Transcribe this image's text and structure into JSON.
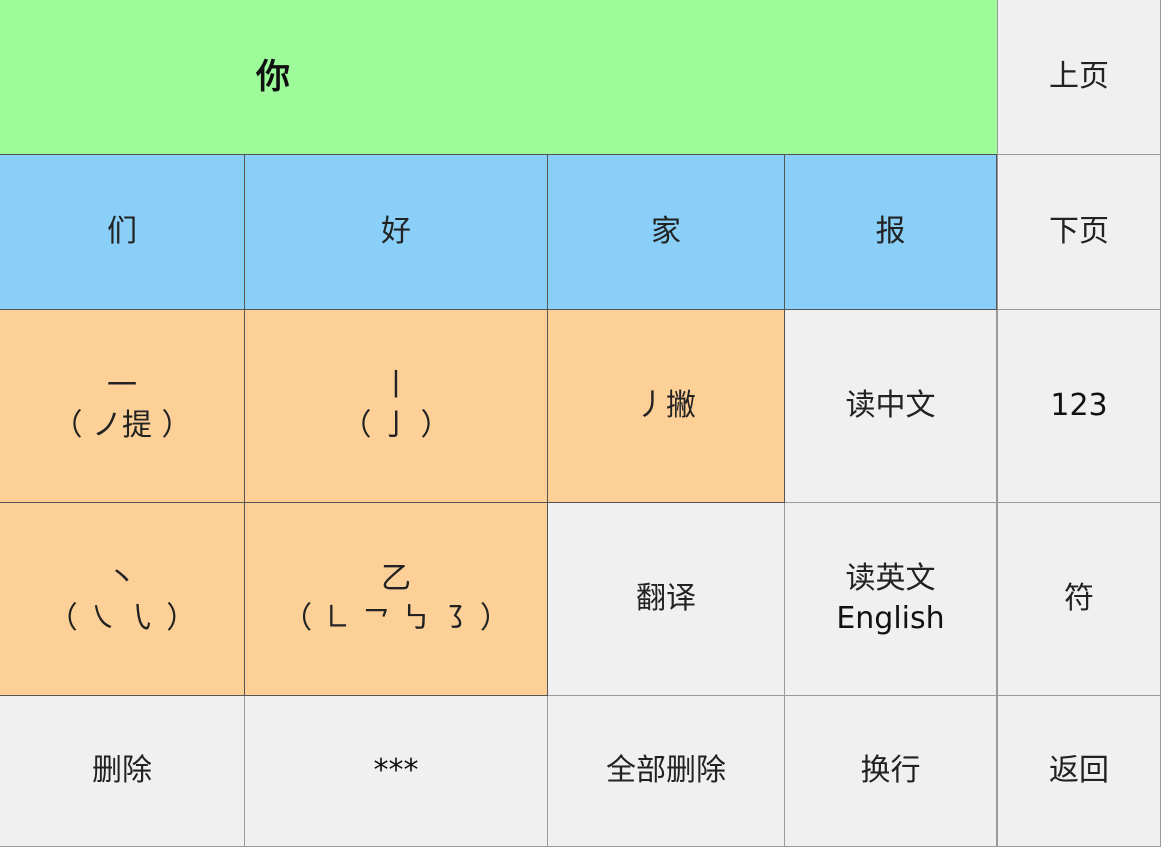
{
  "candidates": {
    "primary": "你",
    "secondary": [
      "们",
      "好",
      "家",
      "报"
    ]
  },
  "nav": {
    "prev_page": "上页",
    "next_page": "下页",
    "numbers": "123",
    "symbols": "符",
    "back": "返回"
  },
  "strokes": {
    "heng": {
      "main": "一",
      "sub": "（ ノ提 ）"
    },
    "shu": {
      "main": "丨",
      "sub": "（ 亅 ）"
    },
    "pie": {
      "main": "丿撇"
    },
    "dian": {
      "main": "丶",
      "sub": "（ ㇏ ㇂ ）"
    },
    "zhe": {
      "main": "乙",
      "sub": "（ ㇗ ㇖ ㇉ ㇌ ）"
    }
  },
  "actions": {
    "read_chinese": "读中文",
    "translate": "翻译",
    "read_english_line1": "读英文",
    "read_english_line2": "English",
    "delete": "删除",
    "wildcard": "***",
    "delete_all": "全部删除",
    "newline": "换行"
  },
  "colors": {
    "candidate_primary_bg": "#9efb9a",
    "candidate_bg": "#89cff8",
    "stroke_bg": "#fdd098",
    "function_bg": "#f0f0f0"
  }
}
